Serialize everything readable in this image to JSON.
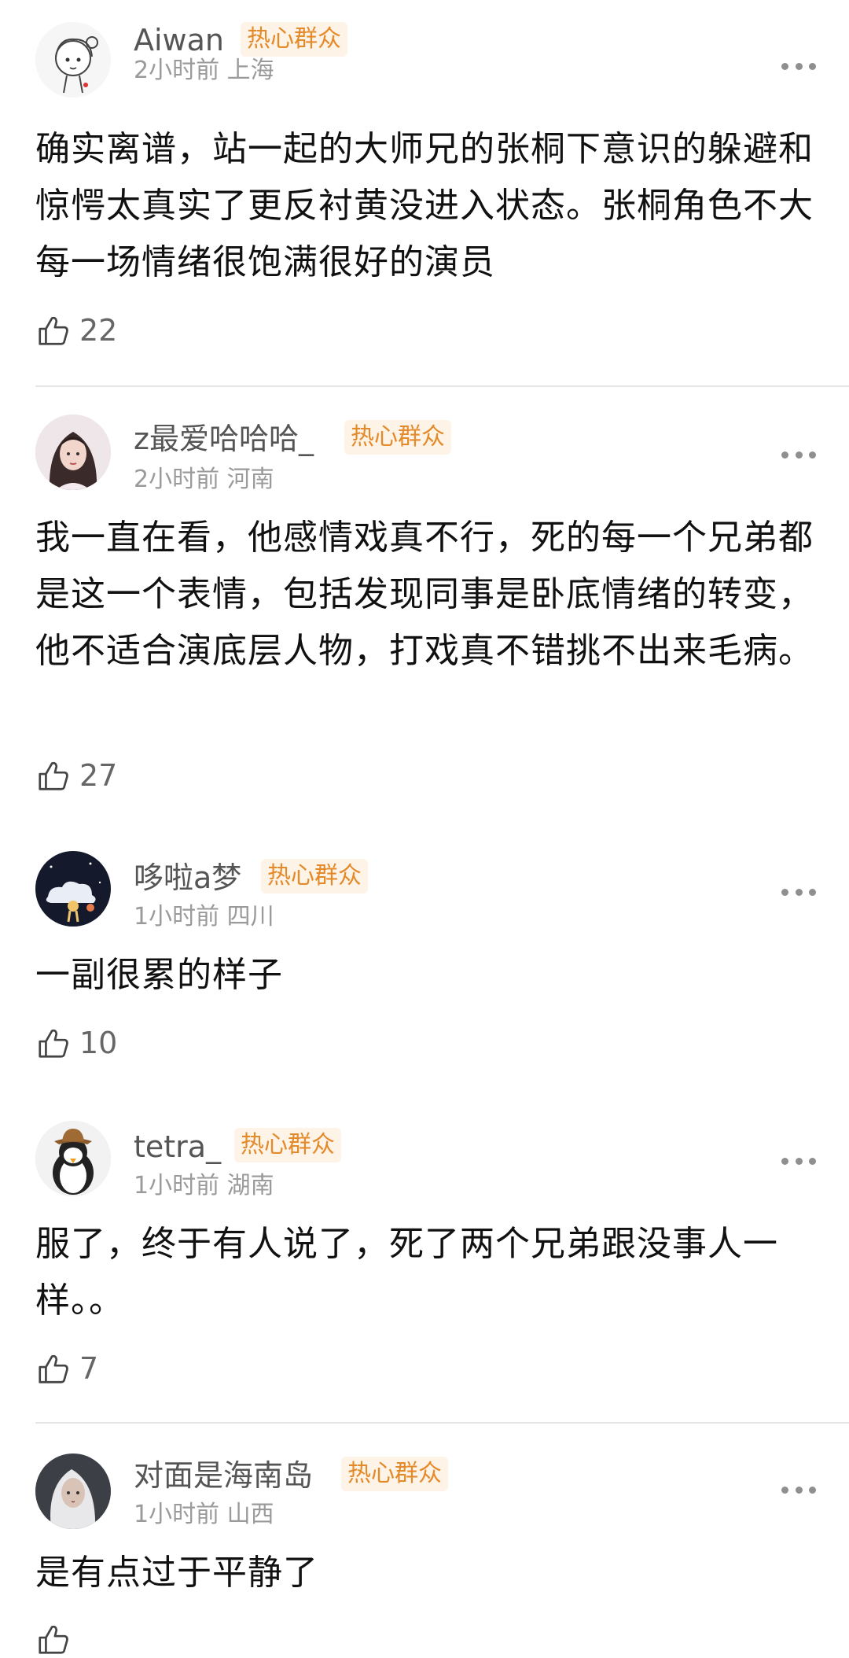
{
  "comments": [
    {
      "username": "Aiwan",
      "badge": "热心群众",
      "time": "2小时前",
      "location": "上海",
      "text": "确实离谱，站一起的大师兄的张桐下意识的躲避和惊愕太真实了更反衬黄没进入状态。张桐角色不大每一场情绪很饱满很好的演员",
      "likes": "22",
      "avatar_icon": "sketch-girl-avatar"
    },
    {
      "username": "z最爱哈哈哈_",
      "badge": "热心群众",
      "time": "2小时前",
      "location": "河南",
      "text": "我一直在看，他感情戏真不行，死的每一个兄弟都是这一个表情，包括发现同事是卧底情绪的转变，他不适合演底层人物，打戏真不错挑不出来毛病。",
      "likes": "27",
      "avatar_icon": "woman-portrait-avatar"
    },
    {
      "username": "哆啦a梦",
      "badge": "热心群众",
      "time": "1小时前",
      "location": "四川",
      "text": "一副很累的样子",
      "likes": "10",
      "avatar_icon": "night-sky-avatar"
    },
    {
      "username": "tetra_",
      "badge": "热心群众",
      "time": "1小时前",
      "location": "湖南",
      "text": "服了，终于有人说了，死了两个兄弟跟没事人一样。。",
      "likes": "7",
      "avatar_icon": "penguin-cowboy-avatar"
    },
    {
      "username": "对面是海南岛",
      "badge": "热心群众",
      "time": "1小时前",
      "location": "山西",
      "text": "是有点过于平静了",
      "likes": "",
      "avatar_icon": "white-hair-avatar"
    }
  ],
  "icons": {
    "like": "thumbs-up-icon",
    "more": "more-dots-icon"
  },
  "colors": {
    "badge_text": "#e48a2a",
    "badge_bg": "#fdf3e6",
    "meta": "#9a9a9a",
    "username": "#555555"
  }
}
